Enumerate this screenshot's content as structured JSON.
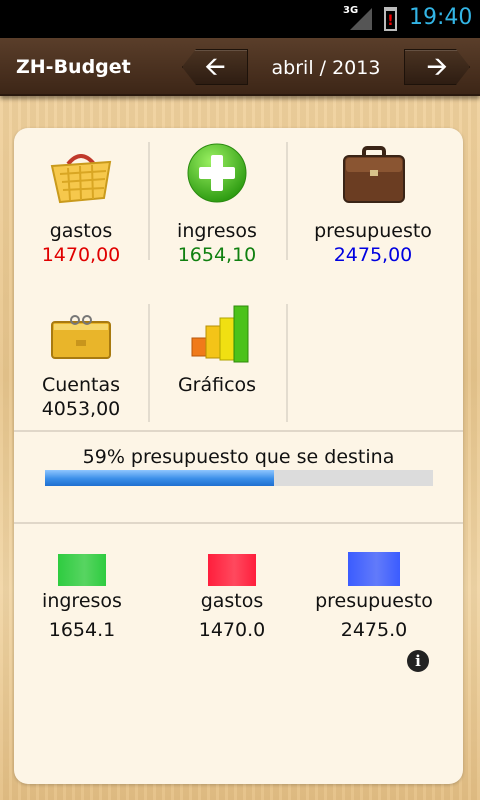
{
  "status_bar": {
    "network": "3G",
    "time": "19:40"
  },
  "action_bar": {
    "title": "ZH-Budget",
    "period": "abril / 2013",
    "prev_icon": "arrow-left",
    "next_icon": "arrow-right"
  },
  "tiles": {
    "gastos": {
      "label": "gastos",
      "value": "1470,00",
      "color": "#e00000"
    },
    "ingresos": {
      "label": "ingresos",
      "value": "1654,10",
      "color": "#108010"
    },
    "presupuesto": {
      "label": "presupuesto",
      "value": "2475,00",
      "color": "#0000e0"
    },
    "cuentas": {
      "label": "Cuentas",
      "value": "4053,00"
    },
    "graficos": {
      "label": "Gráficos"
    }
  },
  "progress": {
    "text": "59% presupuesto que se destina",
    "fraction": 0.59
  },
  "legend": [
    {
      "label": "ingresos",
      "value": "1654.1",
      "color": "#2ecc40"
    },
    {
      "label": "gastos",
      "value": "1470.0",
      "color": "#ff1e3c"
    },
    {
      "label": "presupuesto",
      "value": "2475.0",
      "color": "#3b5cff"
    }
  ]
}
